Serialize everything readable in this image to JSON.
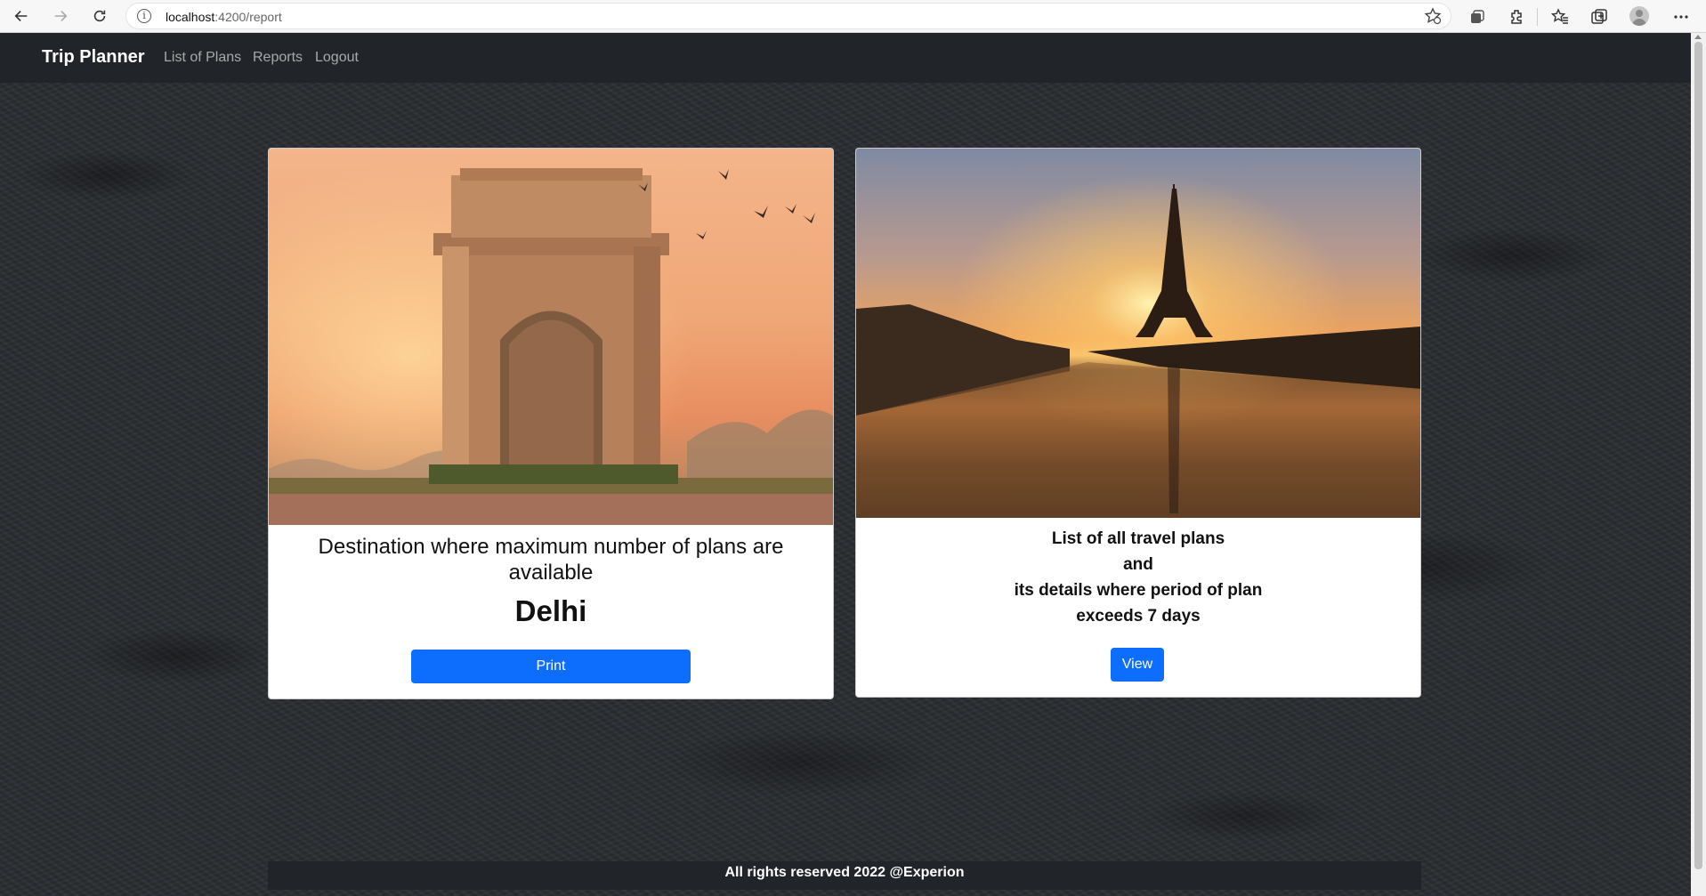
{
  "browser": {
    "url_host": "localhost",
    "url_rest": ":4200/report"
  },
  "navbar": {
    "brand": "Trip Planner",
    "links": [
      "List of Plans",
      "Reports",
      "Logout"
    ]
  },
  "cards": {
    "left": {
      "title": "Destination where maximum number of plans are available",
      "city": "Delhi",
      "button": "Print",
      "image": "india-gate-photo"
    },
    "right": {
      "lines": [
        "List of all travel plans",
        "and",
        "its details where period of plan",
        "exceeds 7 days"
      ],
      "button": "View",
      "image": "eiffel-tower-photo"
    }
  },
  "footer": {
    "text": "All rights reserved 2022 @Experion"
  },
  "colors": {
    "navbar": "#212529",
    "primary_button": "#0d6efd"
  }
}
